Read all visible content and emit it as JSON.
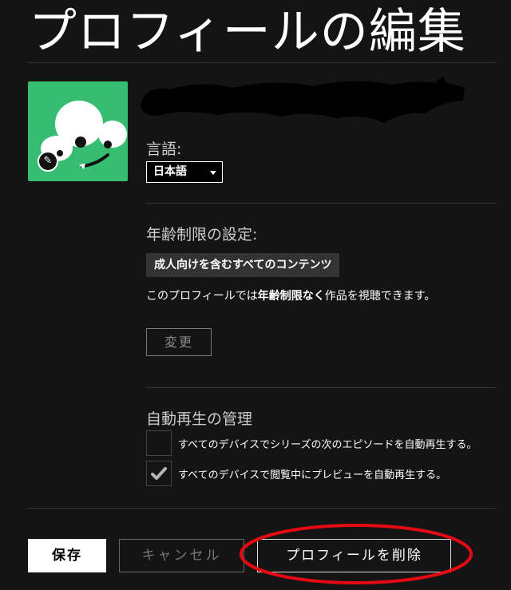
{
  "page": {
    "title": "プロフィールの編集"
  },
  "profile": {
    "avatar_icon": "green-monster-avatar",
    "edit_icon": "pencil-icon"
  },
  "language": {
    "label": "言語:",
    "selected": "日本語"
  },
  "maturity": {
    "label": "年齢制限の設定:",
    "rating": "成人向けを含むすべてのコンテンツ",
    "description_before": "このプロフィールでは",
    "description_bold": "年齢制限なく",
    "description_after": "作品を視聴できます。",
    "change_button": "変更"
  },
  "autoplay": {
    "label": "自動再生の管理",
    "options": [
      {
        "label": "すべてのデバイスでシリーズの次のエピソードを自動再生する。",
        "checked": false
      },
      {
        "label": "すべてのデバイスで閲覧中にプレビューを自動再生する。",
        "checked": true
      }
    ]
  },
  "actions": {
    "save": "保存",
    "cancel": "キャンセル",
    "delete": "プロフィールを削除"
  },
  "colors": {
    "background": "#141414",
    "avatar_bg": "#36bd72",
    "annotation": "#e50914"
  }
}
